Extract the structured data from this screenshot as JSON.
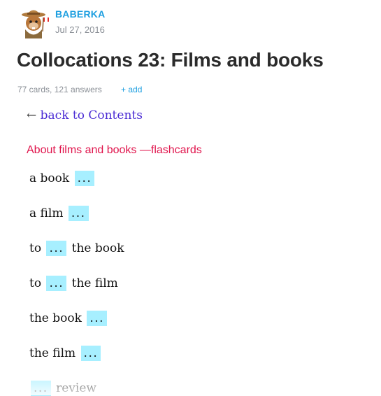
{
  "author": {
    "name": "BABERKA",
    "date": "Jul 27, 2016",
    "avatar_icon": "beaver-ranger-icon"
  },
  "deck": {
    "title": "Collocations 23: Films and books",
    "stats": "77 cards, 121 answers",
    "add_label": "+ add"
  },
  "nav": {
    "arrow": "←",
    "back_label": "back to Contents"
  },
  "section": {
    "title": "About films and books —flashcards"
  },
  "cards": [
    {
      "before": "a book",
      "blank": "...",
      "after": ""
    },
    {
      "before": "a film",
      "blank": "...",
      "after": ""
    },
    {
      "before": "to",
      "blank": "...",
      "after": "the book"
    },
    {
      "before": "to",
      "blank": "...",
      "after": "the film"
    },
    {
      "before": "the book",
      "blank": "...",
      "after": ""
    },
    {
      "before": "the film",
      "blank": "...",
      "after": ""
    },
    {
      "before": "",
      "blank": "...",
      "after": "review"
    }
  ],
  "colors": {
    "accent": "#1e9fe0",
    "section": "#e0144c",
    "link": "#4a2bd4",
    "blank_bg": "#a7efff"
  }
}
